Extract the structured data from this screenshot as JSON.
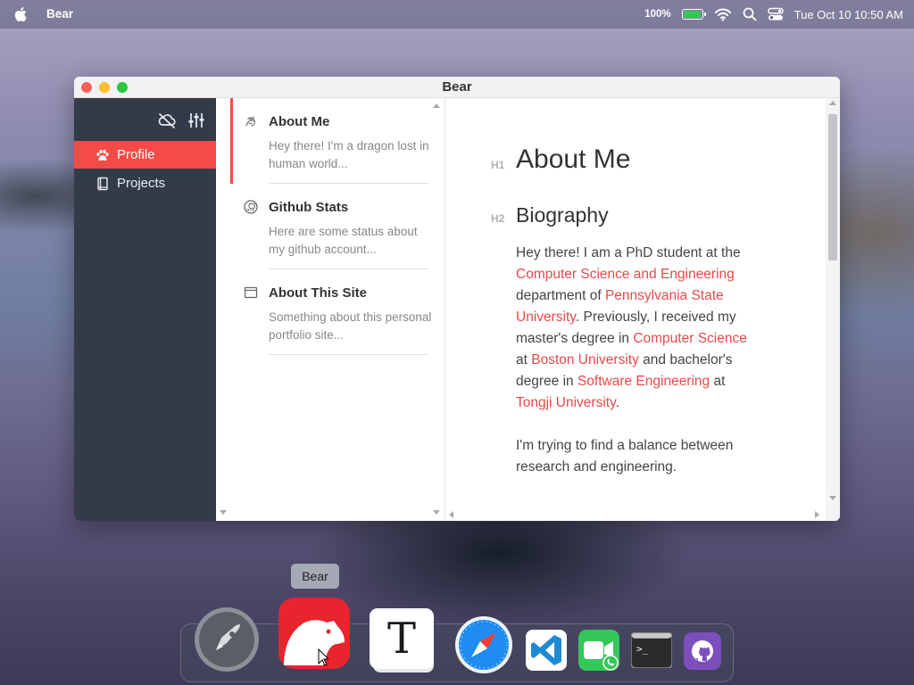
{
  "menubar": {
    "app_name": "Bear",
    "battery_percent": "100%",
    "battery_level": 1.0,
    "clock": "Tue Oct 10  10:50 AM",
    "icons": [
      "apple-icon",
      "battery-icon",
      "wifi-icon",
      "search-icon",
      "control-center-icon"
    ]
  },
  "window": {
    "title": "Bear",
    "sidebar": {
      "toolbar_icons": [
        "cloud-off-icon",
        "sliders-icon"
      ],
      "items": [
        {
          "label": "Profile",
          "icon": "paw-icon",
          "active": true
        },
        {
          "label": "Projects",
          "icon": "book-icon",
          "active": false
        }
      ]
    },
    "notes": [
      {
        "title": "About Me",
        "excerpt": "Hey there! I'm a dragon lost in human world...",
        "icon": "dragon-icon",
        "selected": true
      },
      {
        "title": "Github Stats",
        "excerpt": "Here are some status about my github account...",
        "icon": "github-icon",
        "selected": false
      },
      {
        "title": "About This Site",
        "excerpt": "Something about this personal portfolio site...",
        "icon": "browser-window-icon",
        "selected": false
      }
    ],
    "editor": {
      "h1_hint": "H1",
      "h1": "About Me",
      "h2_hint": "H2",
      "h2": "Biography",
      "para1": [
        {
          "text": "Hey there! I am a PhD student at the ",
          "link": false
        },
        {
          "text": "Computer Science and Engineering",
          "link": true
        },
        {
          "text": " department of ",
          "link": false
        },
        {
          "text": "Pennsylvania State University",
          "link": true
        },
        {
          "text": ". Previously, I received my master's degree in ",
          "link": false
        },
        {
          "text": "Computer Science",
          "link": true
        },
        {
          "text": " at ",
          "link": false
        },
        {
          "text": "Boston University",
          "link": true
        },
        {
          "text": " and bachelor's degree in ",
          "link": false
        },
        {
          "text": "Software Engineering",
          "link": true
        },
        {
          "text": " at ",
          "link": false
        },
        {
          "text": "Tongji University",
          "link": true
        },
        {
          "text": ".",
          "link": false
        }
      ],
      "para2": "I'm trying to find a balance between research and engineering."
    }
  },
  "dock": {
    "tooltip": "Bear",
    "apps": [
      {
        "name": "launchpad-icon"
      },
      {
        "name": "bear-icon"
      },
      {
        "name": "typora-icon",
        "glyph": "T"
      },
      {
        "name": "safari-icon"
      },
      {
        "name": "vscode-icon"
      },
      {
        "name": "facetime-icon"
      },
      {
        "name": "terminal-icon",
        "glyph": ">_"
      },
      {
        "name": "github-desktop-icon"
      }
    ]
  },
  "colors": {
    "accent": "#f44b47",
    "sidebar": "#343b48",
    "link": "#e8484a"
  }
}
